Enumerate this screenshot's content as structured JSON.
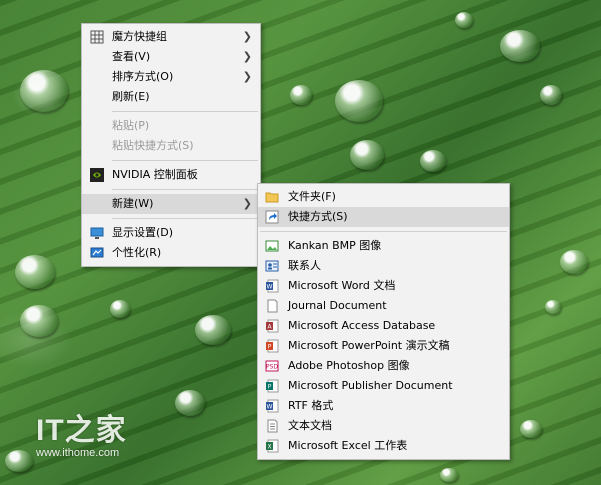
{
  "main_menu": {
    "items": [
      {
        "label": "魔方快捷组",
        "icon": "grid-icon",
        "has_submenu": true,
        "disabled": false
      },
      {
        "label": "查看(V)",
        "icon": "",
        "has_submenu": true,
        "disabled": false
      },
      {
        "label": "排序方式(O)",
        "icon": "",
        "has_submenu": true,
        "disabled": false
      },
      {
        "label": "刷新(E)",
        "icon": "",
        "has_submenu": false,
        "disabled": false
      },
      {
        "label": "粘贴(P)",
        "icon": "",
        "has_submenu": false,
        "disabled": true
      },
      {
        "label": "粘贴快捷方式(S)",
        "icon": "",
        "has_submenu": false,
        "disabled": true
      },
      {
        "label": "NVIDIA 控制面板",
        "icon": "nvidia-icon",
        "has_submenu": false,
        "disabled": false
      },
      {
        "label": "新建(W)",
        "icon": "",
        "has_submenu": true,
        "disabled": false,
        "highlighted": true
      },
      {
        "label": "显示设置(D)",
        "icon": "display-icon",
        "has_submenu": false,
        "disabled": false
      },
      {
        "label": "个性化(R)",
        "icon": "personalize-icon",
        "has_submenu": false,
        "disabled": false
      }
    ]
  },
  "new_submenu": {
    "items": [
      {
        "label": "文件夹(F)",
        "icon": "folder-icon"
      },
      {
        "label": "快捷方式(S)",
        "icon": "shortcut-icon",
        "highlighted": true
      },
      {
        "label": "Kankan BMP 图像",
        "icon": "bmp-image-icon"
      },
      {
        "label": "联系人",
        "icon": "contact-icon"
      },
      {
        "label": "Microsoft Word 文档",
        "icon": "word-doc-icon"
      },
      {
        "label": "Journal Document",
        "icon": "journal-doc-icon"
      },
      {
        "label": "Microsoft Access Database",
        "icon": "access-db-icon"
      },
      {
        "label": "Microsoft PowerPoint 演示文稿",
        "icon": "powerpoint-icon"
      },
      {
        "label": "Adobe Photoshop 图像",
        "icon": "photoshop-icon"
      },
      {
        "label": "Microsoft Publisher Document",
        "icon": "publisher-icon"
      },
      {
        "label": "RTF 格式",
        "icon": "rtf-icon"
      },
      {
        "label": "文本文档",
        "icon": "text-doc-icon"
      },
      {
        "label": "Microsoft Excel 工作表",
        "icon": "excel-icon"
      }
    ]
  },
  "watermark": {
    "logo": "IT之家",
    "url": "www.ithome.com"
  },
  "colors": {
    "menu_bg": "#f2f2f2",
    "highlight": "#d9d9d9",
    "disabled_text": "#9a9a9a",
    "leaf_green": "#3f7d2c"
  }
}
